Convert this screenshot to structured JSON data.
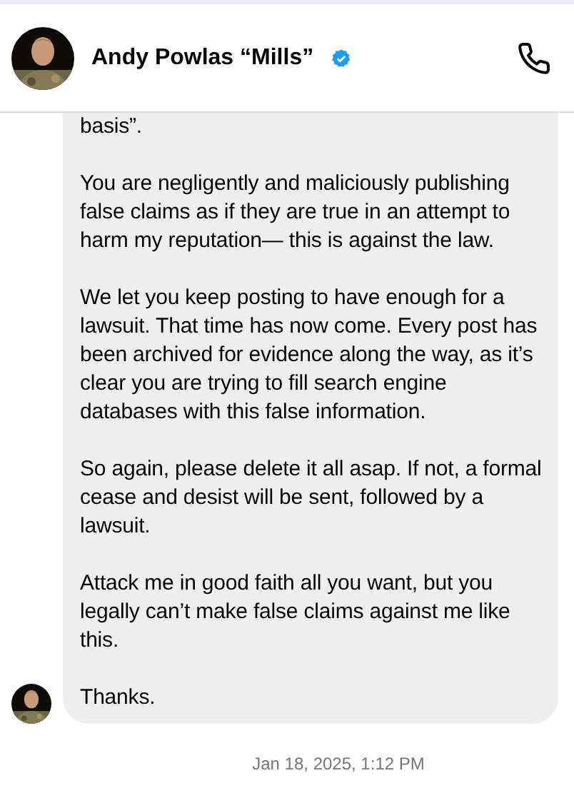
{
  "header": {
    "name": "Andy Powlas “Mills”",
    "verified": true
  },
  "message": {
    "paragraphs": [
      "basis”.",
      "You are negligently and maliciously publishing false claims as if they are true in an attempt to harm my reputation— this is against the law.",
      "We let you keep posting to have enough for a lawsuit. That time has now come. Every post has been archived for evidence along the way, as it’s clear you are trying to fill search engine databases with this false information.",
      "So again, please delete it all asap. If not, a formal cease and desist will be sent, followed by a lawsuit.",
      "Attack me in good faith all you want, but you legally can’t make false claims against me like this.",
      "Thanks."
    ]
  },
  "timestamp": "Jan 18, 2025, 1:12 PM"
}
